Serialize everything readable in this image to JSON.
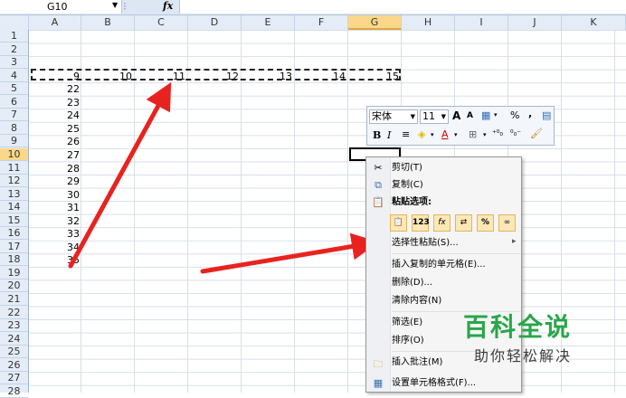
{
  "formula_bar": {
    "name_box": "G10",
    "fx": "fx"
  },
  "columns": [
    "A",
    "B",
    "C",
    "D",
    "E",
    "F",
    "G",
    "H",
    "I",
    "J",
    "K"
  ],
  "selected_column": "G",
  "rows": [
    "1",
    "2",
    "3",
    "4",
    "5",
    "6",
    "7",
    "8",
    "9",
    "10",
    "11",
    "12",
    "13",
    "14",
    "15",
    "16",
    "17",
    "18",
    "19",
    "20",
    "21",
    "22",
    "23",
    "24",
    "25",
    "26",
    "27",
    "28"
  ],
  "selected_row": "10",
  "copied_row": {
    "row": "4",
    "values": [
      "9",
      "10",
      "11",
      "12",
      "13",
      "14",
      "15"
    ]
  },
  "column_a_values": [
    "22",
    "23",
    "24",
    "25",
    "26",
    "27",
    "28",
    "29",
    "30",
    "31",
    "32",
    "33",
    "34",
    "35"
  ],
  "mini_toolbar": {
    "font_name": "宋体",
    "font_size": "11",
    "grow_font": "A",
    "shrink_font": "A",
    "percent": "%",
    "comma": ",",
    "bold": "B",
    "italic": "I",
    "font_color": "A"
  },
  "context_menu": {
    "cut": "剪切(T)",
    "copy": "复制(C)",
    "paste_options": "粘贴选项:",
    "paste_buttons": [
      "📋",
      "123",
      "fx",
      "⇄",
      "%",
      "∞"
    ],
    "paste_special": "选择性粘贴(S)...",
    "insert_copied": "插入复制的单元格(E)...",
    "delete": "删除(D)...",
    "clear": "清除内容(N)",
    "filter": "筛选(E)",
    "sort": "排序(O)",
    "insert_comment": "插入批注(M)",
    "format_cells": "设置单元格格式(F)..."
  },
  "watermark": {
    "title": "百科全说",
    "subtitle": "助你轻松解决"
  },
  "colors": {
    "arrow": "#e8231f",
    "watermark_green": "#29a64a",
    "selection": "#fbd889"
  }
}
